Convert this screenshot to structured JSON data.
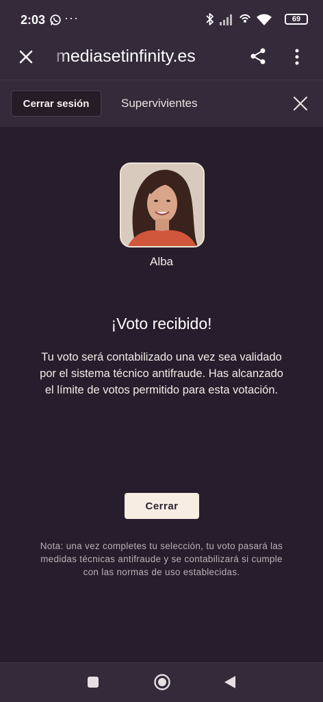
{
  "status_bar": {
    "time": "2:03",
    "more": "···",
    "battery": "69"
  },
  "browser": {
    "url": "mediasetinfinity.es"
  },
  "tab_bar": {
    "logout_label": "Cerrar sesión",
    "title": "Supervivientes"
  },
  "vote": {
    "contestant_name": "Alba",
    "heading": "¡Voto recibido!",
    "message": "Tu voto será contabilizado una vez sea validado por el sistema técnico antifraude. Has alcanzado el límite de votos permitido para esta votación.",
    "close_label": "Cerrar",
    "note": "Nota: una vez completes tu selección, tu voto pasará las medidas técnicas antifraude y se contabilizará si cumple con las normas de uso establecidas."
  },
  "colors": {
    "background": "#271d2c",
    "bar": "#342a3a",
    "accent_button": "#f8ede2"
  },
  "icons": {
    "status_left": [
      "whatsapp-icon"
    ],
    "status_right": [
      "bluetooth-icon",
      "signal-icon",
      "hotspot-icon",
      "wifi-icon",
      "battery-icon"
    ],
    "browser": [
      "close-icon",
      "share-icon",
      "more-vert-icon"
    ],
    "tab_bar": [
      "close-icon"
    ],
    "nav": [
      "recents-icon",
      "home-icon",
      "back-icon"
    ]
  }
}
